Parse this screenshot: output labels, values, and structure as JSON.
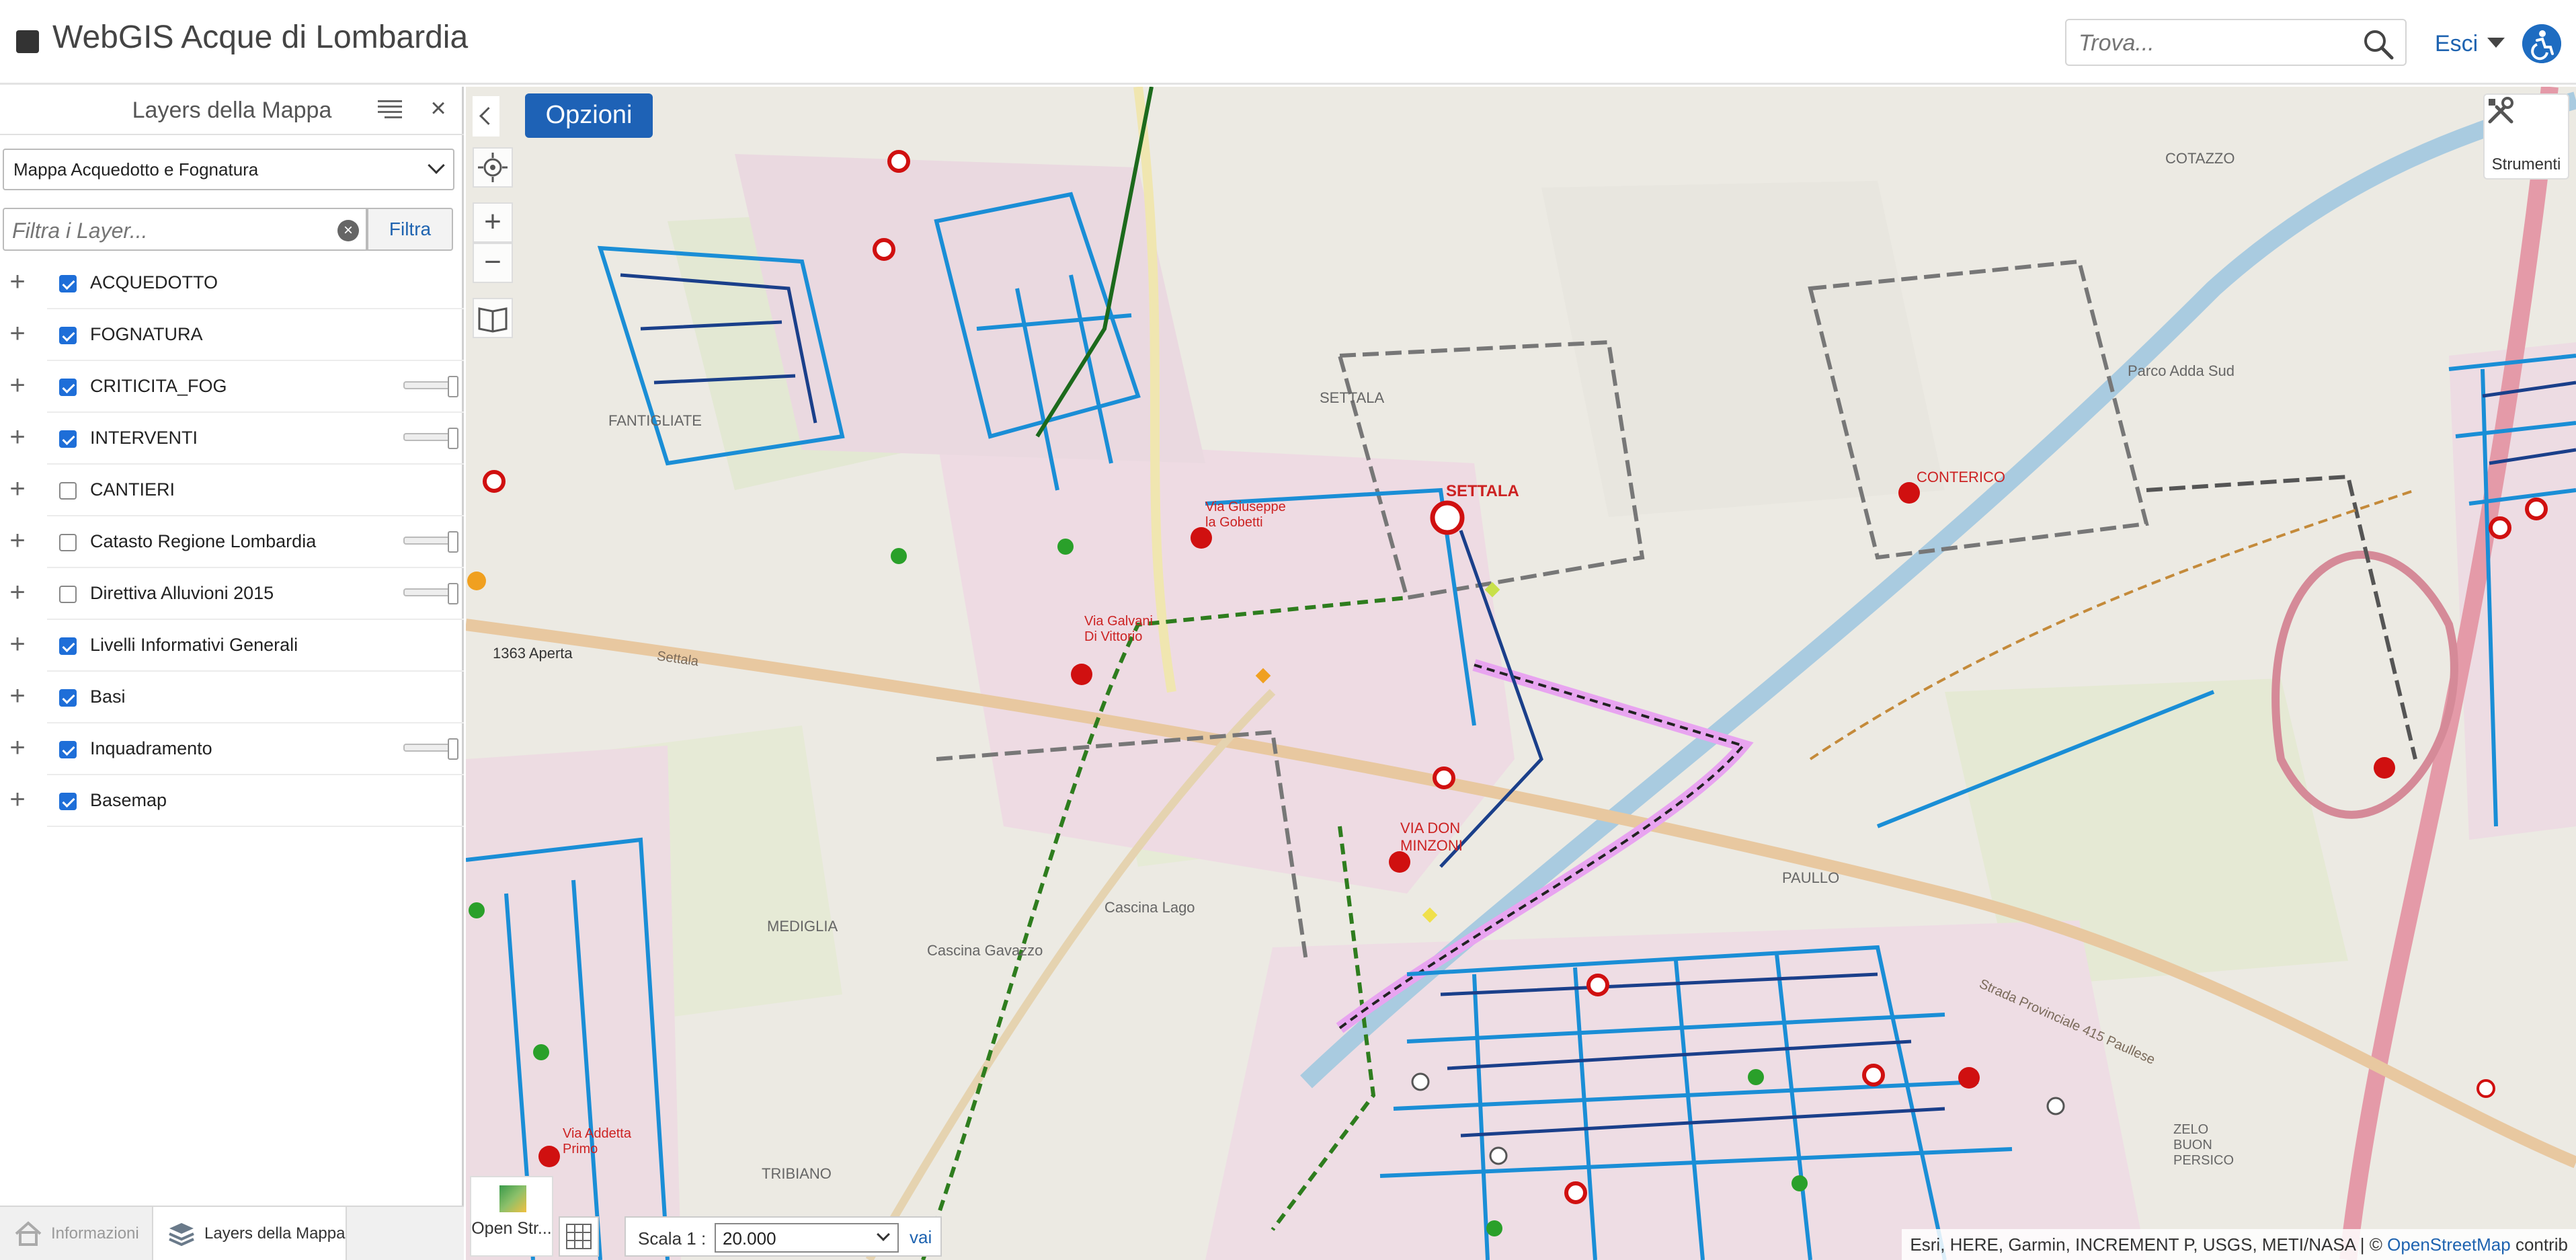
{
  "header": {
    "title": "WebGIS Acque di Lombardia",
    "search_placeholder": "Trova...",
    "logout_label": "Esci"
  },
  "left_panel": {
    "title": "Layers della Mappa",
    "map_select_value": "Mappa Acquedotto e Fognatura",
    "filter_placeholder": "Filtra i Layer...",
    "filter_button": "Filtra",
    "layers": [
      {
        "label": "ACQUEDOTTO",
        "checked": true,
        "slider": false
      },
      {
        "label": "FOGNATURA",
        "checked": true,
        "slider": false
      },
      {
        "label": "CRITICITA_FOG",
        "checked": true,
        "slider": true
      },
      {
        "label": "INTERVENTI",
        "checked": true,
        "slider": true
      },
      {
        "label": "CANTIERI",
        "checked": false,
        "slider": false
      },
      {
        "label": "Catasto Regione Lombardia",
        "checked": false,
        "slider": true
      },
      {
        "label": "Direttiva Alluvioni 2015",
        "checked": false,
        "slider": true
      },
      {
        "label": "Livelli Informativi Generali",
        "checked": true,
        "slider": false
      },
      {
        "label": "Basi",
        "checked": true,
        "slider": false
      },
      {
        "label": "Inquadramento",
        "checked": true,
        "slider": true
      },
      {
        "label": "Basemap",
        "checked": true,
        "slider": false
      }
    ],
    "tabs": {
      "info": "Informazioni",
      "layers": "Layers della Mappa"
    }
  },
  "map": {
    "options_label": "Opzioni",
    "tools_label": "Strumenti",
    "basemap_label": "Open Str...",
    "scale_label": "Scala 1 :",
    "scale_value": "20.000",
    "scale_go": "vai",
    "attribution_text": "Esri, HERE, Garmin, INCREMENT P, USGS, METI/NASA | © ",
    "attribution_link": "OpenStreetMap",
    "attribution_tail": " contrib",
    "labels": {
      "settala_red": "SETTALA",
      "settala": "SETTALA",
      "contefico": "CONTERICO",
      "via_don_minzoni": "VIA DON MINZONI",
      "via_gobetti": "Via Giuseppe la Gobetti",
      "via_galvani": "Via Galvani Di Vittorio",
      "via_addetta": "Via Addetta Primo",
      "mediglia": "MEDIGLIA",
      "cascina_gavazzo": "Cascina Gavazzo",
      "cascina_lago": "Cascina Lago",
      "paullo": "PAULLO",
      "tribiano": "TRIBIANO",
      "fantigliate": "FANTIGLIATE",
      "cotazzo": "COTAZZO",
      "parco": "Parco Adda Sud",
      "sp415": "Strada Provinciale 415 Paullese",
      "zelo": "ZELO BUON PERSICO",
      "aperta": "1363 Aperta",
      "settala_roma": "Settala"
    },
    "accent_color": "#1e62b6"
  }
}
